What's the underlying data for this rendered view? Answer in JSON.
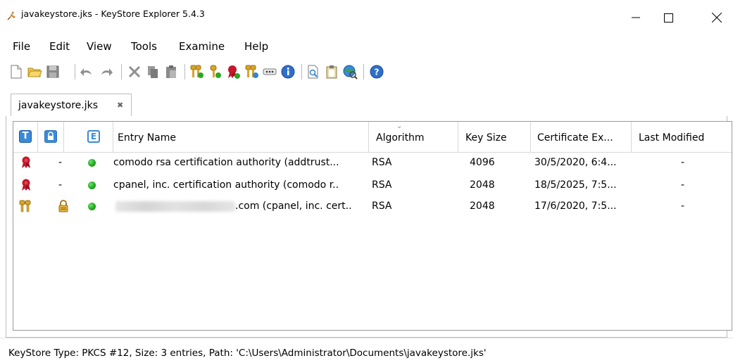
{
  "window": {
    "title": "javakeystore.jks - KeyStore Explorer 5.4.3",
    "controls": {
      "minimize": "minimize-icon",
      "maximize": "maximize-icon",
      "close": "close-icon"
    }
  },
  "menu": [
    "File",
    "Edit",
    "View",
    "Tools",
    "Examine",
    "Help"
  ],
  "toolbar": {
    "buttons": [
      "new-icon",
      "open-icon",
      "save-icon",
      "undo-icon",
      "redo-icon",
      "cut-icon",
      "copy-icon",
      "paste-icon",
      "generate-keypair-icon",
      "generate-secret-key-icon",
      "import-trusted-certificate-icon",
      "import-keypair-icon",
      "set-password-icon",
      "properties-icon",
      "examine-file-icon",
      "examine-clipboard-icon",
      "examine-ssl-icon",
      "help-icon"
    ]
  },
  "tab": {
    "label": "javakeystore.jks",
    "close_icon": "close-tab-icon"
  },
  "table": {
    "headers": {
      "type": "T",
      "lock": "lock-icon",
      "expiry": "E",
      "entry_name": "Entry Name",
      "algorithm": "Algorithm",
      "key_size": "Key Size",
      "cert_expiry": "Certificate Ex...",
      "last_modified": "Last Modified"
    },
    "rows": [
      {
        "type_icon": "trusted-certificate-icon",
        "lock": "-",
        "status": "valid",
        "entry_name": "comodo rsa certification authority (addtrust...",
        "algorithm": "RSA",
        "key_size": "4096",
        "cert_expiry": "30/5/2020, 6:4...",
        "last_modified": "-"
      },
      {
        "type_icon": "trusted-certificate-icon",
        "lock": "-",
        "status": "valid",
        "entry_name": "cpanel, inc. certification authority (comodo r..",
        "algorithm": "RSA",
        "key_size": "2048",
        "cert_expiry": "18/5/2025, 7:5...",
        "last_modified": "-"
      },
      {
        "type_icon": "key-pair-icon",
        "lock": "lock-icon",
        "status": "valid",
        "entry_name": ".com (cpanel, inc. cert..",
        "algorithm": "RSA",
        "key_size": "2048",
        "cert_expiry": "17/6/2020, 7:5...",
        "last_modified": "-"
      }
    ]
  },
  "status": "KeyStore Type: PKCS #12, Size: 3 entries, Path: 'C:\\Users\\Administrator\\Documents\\javakeystore.jks'",
  "colors": {
    "accent_blue": "#2f86d6",
    "valid_green": "#1aa51a",
    "cert_red": "#c4182b",
    "key_gold": "#d6a52a"
  }
}
